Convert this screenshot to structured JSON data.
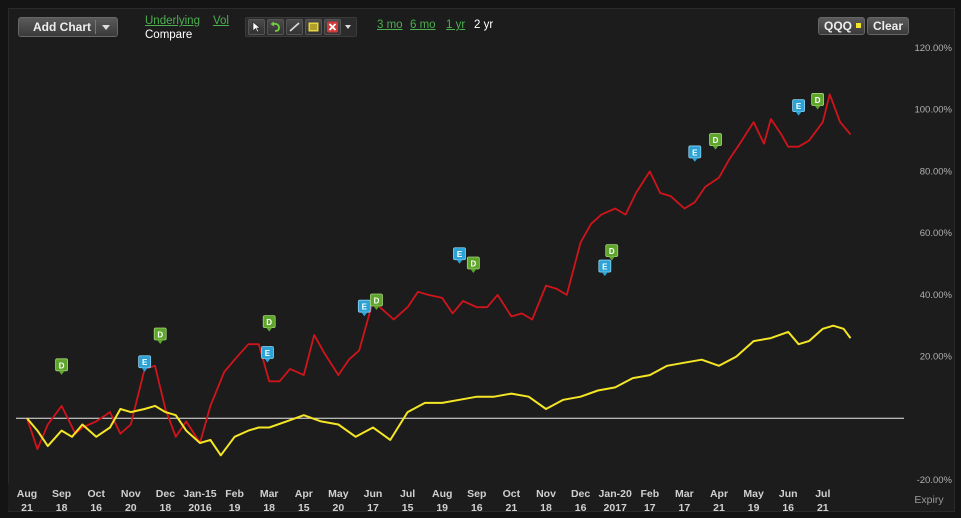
{
  "toolbar": {
    "add_chart_label": "Add Chart",
    "underlying_label": "Underlying",
    "vol_label": "Vol",
    "compare_label": "Compare",
    "ranges": [
      "3 mo",
      "6 mo",
      "1 yr",
      "2 yr"
    ],
    "selected_range": "2 yr",
    "compare_symbol": "QQQ",
    "compare_swatch_color": "#f5e625",
    "clear_label": "Clear",
    "tools": [
      "pointer-icon",
      "undo-icon",
      "trendline-icon",
      "notes-icon",
      "delete-icon"
    ]
  },
  "chart_data": {
    "type": "line",
    "y_axis": {
      "unit": "percent",
      "ticks": [
        "120.00%",
        "100.00%",
        "80.00%",
        "60.00%",
        "40.00%",
        "20.00%",
        "-20.00%"
      ],
      "ylim": [
        -20,
        120
      ],
      "baseline": 0
    },
    "x_axis": {
      "label": "Expiry",
      "ticks": [
        {
          "top": "Aug",
          "bottom": "21"
        },
        {
          "top": "Sep",
          "bottom": "18"
        },
        {
          "top": "Oct",
          "bottom": "16"
        },
        {
          "top": "Nov",
          "bottom": "20"
        },
        {
          "top": "Dec",
          "bottom": "18"
        },
        {
          "top": "Jan-15",
          "bottom": "2016"
        },
        {
          "top": "Feb",
          "bottom": "19"
        },
        {
          "top": "Mar",
          "bottom": "18"
        },
        {
          "top": "Apr",
          "bottom": "15"
        },
        {
          "top": "May",
          "bottom": "20"
        },
        {
          "top": "Jun",
          "bottom": "17"
        },
        {
          "top": "Jul",
          "bottom": "15"
        },
        {
          "top": "Aug",
          "bottom": "19"
        },
        {
          "top": "Sep",
          "bottom": "16"
        },
        {
          "top": "Oct",
          "bottom": "21"
        },
        {
          "top": "Nov",
          "bottom": "18"
        },
        {
          "top": "Dec",
          "bottom": "16"
        },
        {
          "top": "Jan-20",
          "bottom": "2017"
        },
        {
          "top": "Feb",
          "bottom": "17"
        },
        {
          "top": "Mar",
          "bottom": "17"
        },
        {
          "top": "Apr",
          "bottom": "21"
        },
        {
          "top": "May",
          "bottom": "19"
        },
        {
          "top": "Jun",
          "bottom": "16"
        },
        {
          "top": "Jul",
          "bottom": "21"
        }
      ]
    },
    "series": [
      {
        "color": "#d0141b",
        "x": [
          0,
          0.3,
          0.6,
          1,
          1.4,
          1.6,
          2,
          2.4,
          2.7,
          3,
          3.4,
          3.7,
          4,
          4.3,
          4.6,
          5,
          5.3,
          5.7,
          6,
          6.4,
          6.7,
          7,
          7.3,
          7.6,
          8,
          8.3,
          8.6,
          9,
          9.3,
          9.6,
          10,
          10.3,
          10.6,
          11,
          11.3,
          11.6,
          12,
          12.3,
          12.6,
          13,
          13.3,
          13.6,
          14,
          14.3,
          14.6,
          15,
          15.3,
          15.6,
          16,
          16.3,
          16.6,
          17,
          17.3,
          17.6,
          18,
          18.3,
          18.6,
          19,
          19.3,
          19.6,
          20,
          20.3,
          20.6,
          21,
          21.3,
          21.5,
          21.8,
          22,
          22.3,
          22.6,
          23,
          23.2,
          23.5,
          23.8
        ],
        "values": [
          0,
          -10,
          -2,
          4,
          -5,
          -3,
          -1,
          2,
          -5,
          -2,
          16,
          17,
          3,
          -6,
          -1,
          -8,
          4,
          15,
          19,
          24,
          24,
          12,
          12,
          16,
          14,
          27,
          21,
          14,
          19,
          22,
          38,
          35,
          32,
          36,
          41,
          40,
          39,
          34,
          38,
          36,
          36,
          40,
          33,
          34,
          32,
          43,
          42,
          40,
          57,
          63,
          66,
          68,
          66,
          73,
          80,
          73,
          72,
          68,
          70,
          75,
          78,
          84,
          89,
          96,
          89,
          97,
          92,
          88,
          88,
          90,
          96,
          105,
          96,
          92
        ],
        "labels_visible": false
      },
      {
        "color": "#f5e625",
        "x": [
          0,
          0.3,
          0.6,
          1,
          1.3,
          1.6,
          2,
          2.4,
          2.7,
          3,
          3.4,
          3.7,
          4,
          4.3,
          4.6,
          5,
          5.3,
          5.6,
          6,
          6.4,
          6.7,
          7,
          7.5,
          8,
          8.5,
          9,
          9.5,
          10,
          10.5,
          11,
          11.5,
          12,
          12.5,
          13,
          13.5,
          14,
          14.5,
          15,
          15.5,
          16,
          16.5,
          17,
          17.5,
          18,
          18.5,
          19,
          19.5,
          20,
          20.5,
          21,
          21.5,
          22,
          22.3,
          22.6,
          23,
          23.3,
          23.6,
          23.8
        ],
        "values": [
          0,
          -4,
          -9,
          -4,
          -6,
          -2,
          -6,
          -3,
          3,
          2,
          3,
          4,
          2,
          1,
          -4,
          -8,
          -7,
          -12,
          -6,
          -4,
          -3,
          -3,
          -1,
          1,
          -1,
          -2,
          -6,
          -3,
          -7,
          2,
          5,
          5,
          6,
          7,
          7,
          8,
          7,
          3,
          6,
          7,
          9,
          10,
          13,
          14,
          17,
          18,
          19,
          17,
          20,
          25,
          26,
          28,
          24,
          25,
          29,
          30,
          29,
          26
        ],
        "labels_visible": false
      }
    ],
    "events": [
      {
        "type": "D",
        "x": 1.0,
        "y": 17
      },
      {
        "type": "E",
        "x": 3.4,
        "y": 18
      },
      {
        "type": "D",
        "x": 3.85,
        "y": 27
      },
      {
        "type": "D",
        "x": 7.0,
        "y": 31
      },
      {
        "type": "E",
        "x": 6.95,
        "y": 21
      },
      {
        "type": "E",
        "x": 9.75,
        "y": 36
      },
      {
        "type": "D",
        "x": 10.1,
        "y": 38
      },
      {
        "type": "E",
        "x": 12.5,
        "y": 53
      },
      {
        "type": "D",
        "x": 12.9,
        "y": 50
      },
      {
        "type": "D",
        "x": 16.9,
        "y": 54
      },
      {
        "type": "E",
        "x": 16.7,
        "y": 49
      },
      {
        "type": "E",
        "x": 19.3,
        "y": 86
      },
      {
        "type": "D",
        "x": 19.9,
        "y": 90
      },
      {
        "type": "E",
        "x": 22.3,
        "y": 101
      },
      {
        "type": "D",
        "x": 22.85,
        "y": 103
      }
    ],
    "legend": "none",
    "grid": false
  }
}
